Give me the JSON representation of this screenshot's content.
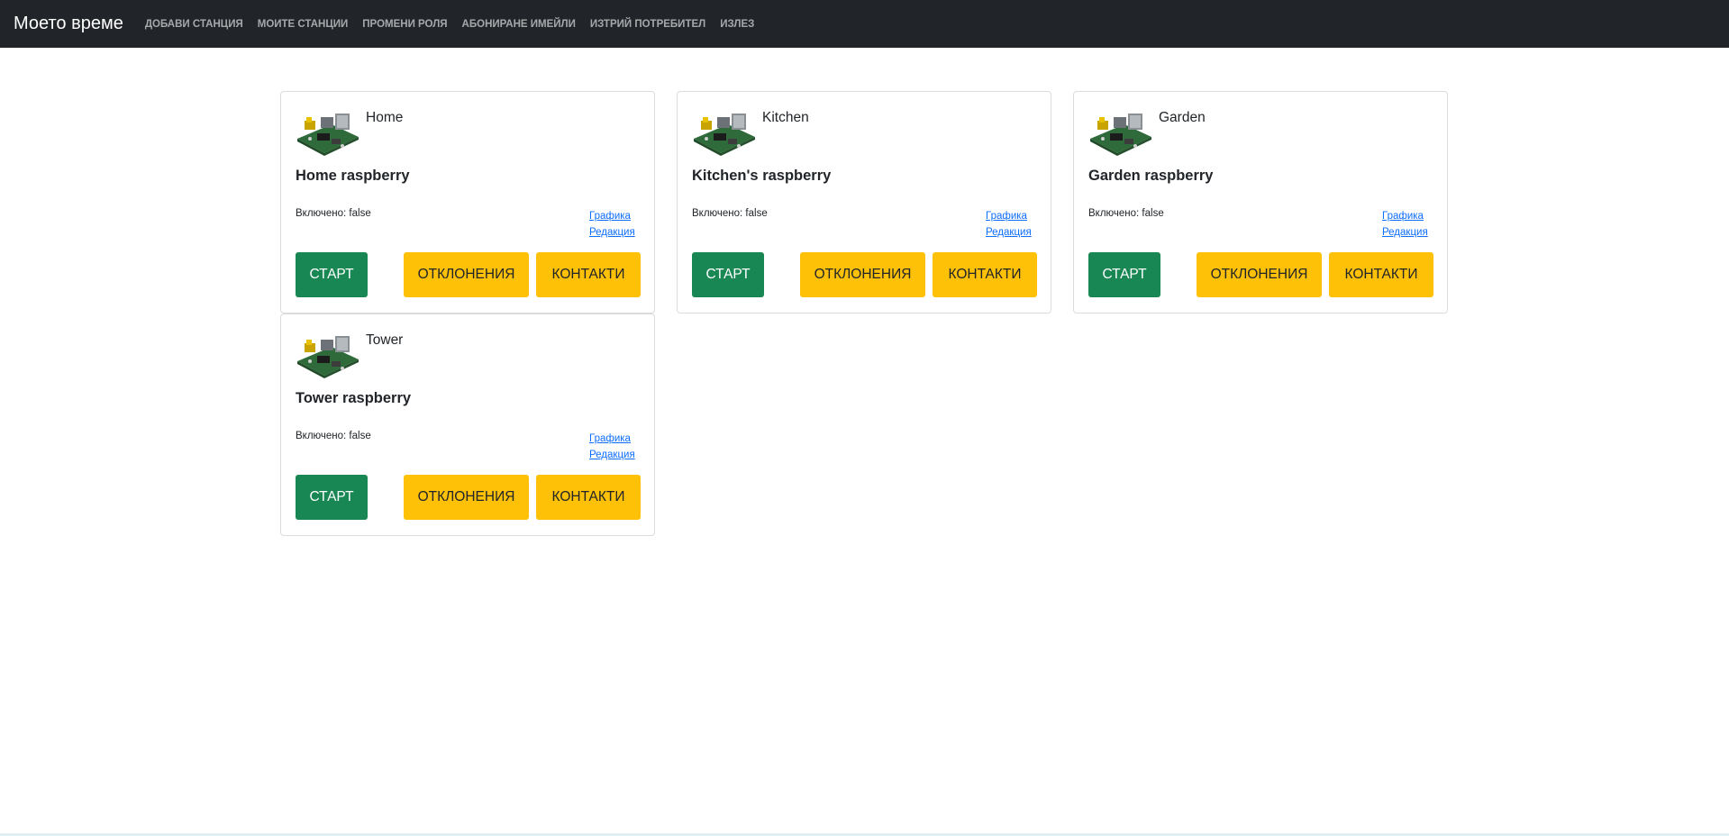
{
  "navbar": {
    "brand": "Моето време",
    "links": [
      "ДОБАВИ СТАНЦИЯ",
      "МОИТЕ СТАНЦИИ",
      "ПРОМЕНИ РОЛЯ",
      "АБОНИРАНЕ ИМЕЙЛИ",
      "ИЗТРИЙ ПОТРЕБИТЕЛ",
      "ИЗЛЕЗ"
    ]
  },
  "stations": [
    {
      "name": "Home",
      "title": "Home raspberry",
      "enabled": "Включено: false",
      "chart_link": "Графика",
      "edit_link": "Редакция",
      "start_label": "СТАРТ",
      "deviations_label": "ОТКЛОНЕНИЯ",
      "contacts_label": "КОНТАКТИ"
    },
    {
      "name": "Kitchen",
      "title": "Kitchen's raspberry",
      "enabled": "Включено: false",
      "chart_link": "Графика",
      "edit_link": "Редакция",
      "start_label": "СТАРТ",
      "deviations_label": "ОТКЛОНЕНИЯ",
      "contacts_label": "КОНТАКТИ"
    },
    {
      "name": "Garden",
      "title": "Garden raspberry",
      "enabled": "Включено: false",
      "chart_link": "Графика",
      "edit_link": "Редакция",
      "start_label": "СТАРТ",
      "deviations_label": "ОТКЛОНЕНИЯ",
      "contacts_label": "КОНТАКТИ"
    },
    {
      "name": "Tower",
      "title": "Tower raspberry",
      "enabled": "Включено: false",
      "chart_link": "Графика",
      "edit_link": "Редакция",
      "start_label": "СТАРТ",
      "deviations_label": "ОТКЛОНЕНИЯ",
      "contacts_label": "КОНТАКТИ"
    }
  ],
  "colors": {
    "navbar": "#212529",
    "start_button": "#198754",
    "warning_button": "#ffc107",
    "link": "#0d6efd"
  },
  "icons": {
    "station_thumbnail": "raspberry-pi-board-icon"
  }
}
